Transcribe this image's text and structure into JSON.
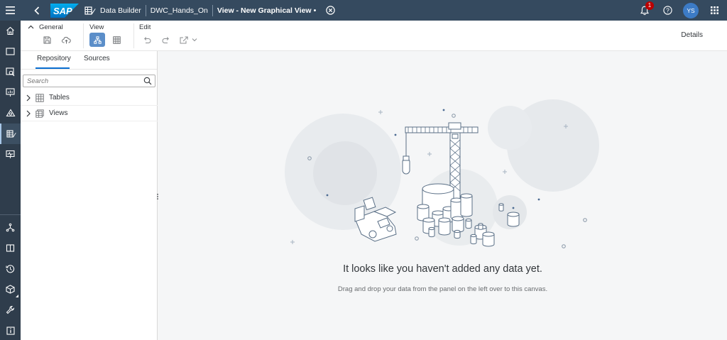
{
  "shell": {
    "logo_text": "SAP",
    "breadcrumbs": [
      "Data Builder",
      "DWC_Hands_On",
      "View - New Graphical View"
    ],
    "unsaved_marker": "•",
    "notification_count": "1",
    "user_initials": "YS"
  },
  "sidenav": {
    "items": [
      "home-icon",
      "folder-icon",
      "search-catalog-icon",
      "presentation-icon",
      "business-builder-icon",
      "data-builder-icon",
      "monitor-icon",
      "data-flow-icon",
      "repository-book-icon",
      "history-icon",
      "package-icon",
      "tools-icon",
      "info-icon"
    ]
  },
  "toolbar": {
    "general_label": "General",
    "view_label": "View",
    "edit_label": "Edit",
    "details_label": "Details"
  },
  "panel": {
    "tabs": [
      "Repository",
      "Sources"
    ],
    "search_placeholder": "Search",
    "tree": [
      {
        "label": "Tables",
        "icon": "table-icon"
      },
      {
        "label": "Views",
        "icon": "view-icon"
      }
    ]
  },
  "canvas": {
    "empty_title": "It looks like you haven't added any data yet.",
    "empty_subtitle": "Drag and drop your data from the panel on the left over to this canvas."
  },
  "colors": {
    "shell_bg": "#354a5f",
    "sidenav_bg": "#2f3d4c",
    "accent": "#0a6ed1",
    "badge": "#bb0000",
    "avatar": "#3c7bc6"
  }
}
